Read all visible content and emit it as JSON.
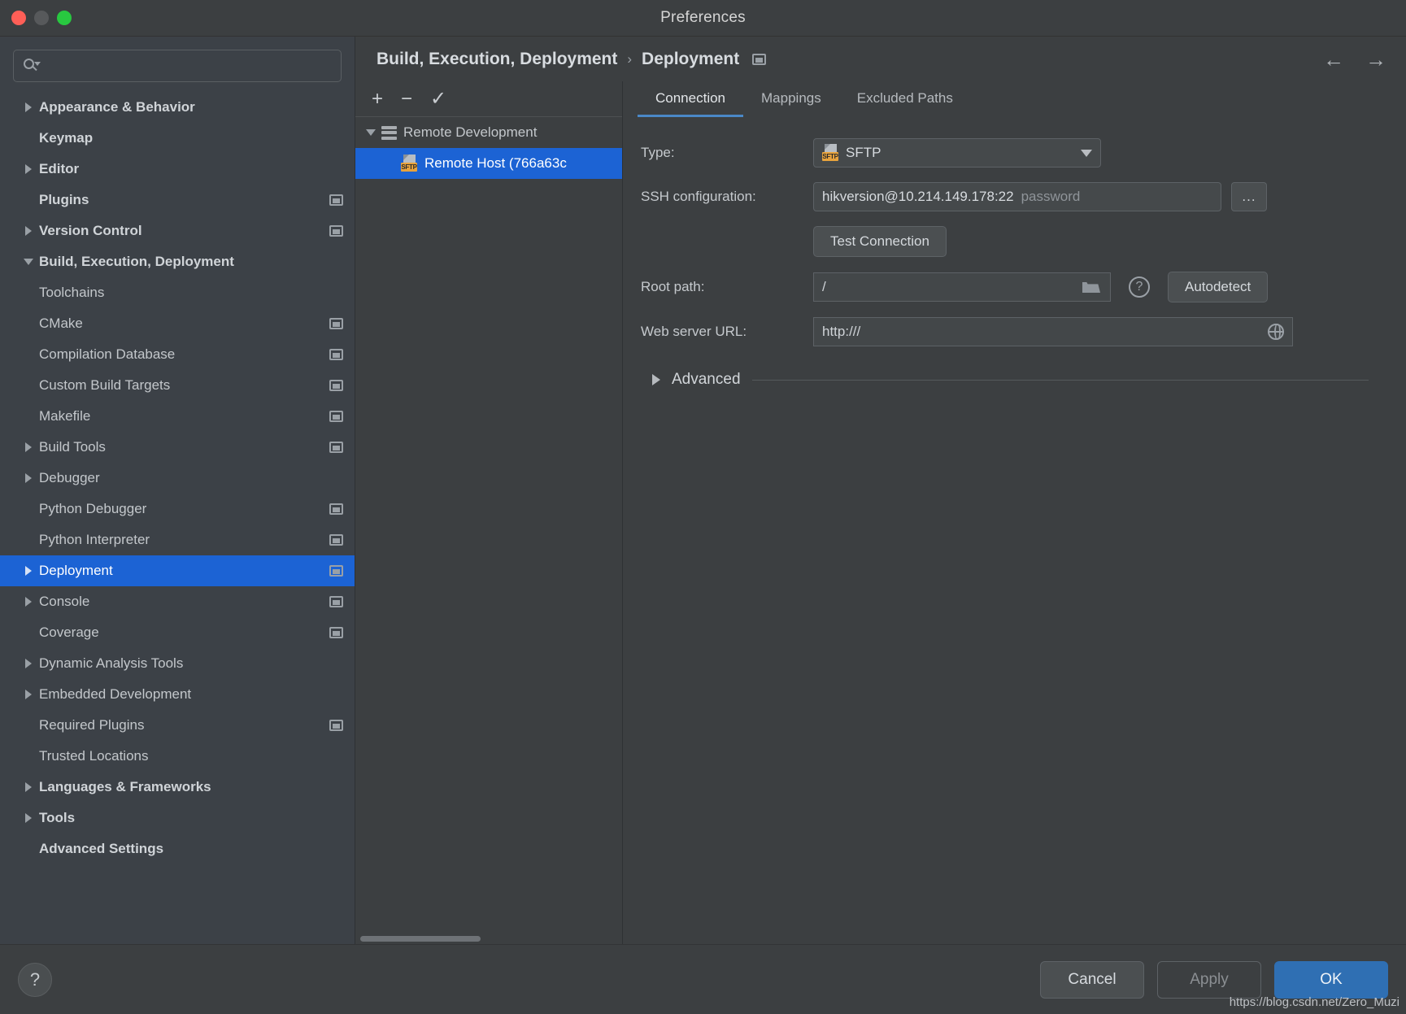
{
  "window": {
    "title": "Preferences",
    "traffic_lights": [
      "close-red",
      "minimize-yellow",
      "zoom-green"
    ]
  },
  "search": {
    "placeholder": "",
    "value": ""
  },
  "sidebar": {
    "items": [
      {
        "label": "Appearance & Behavior",
        "indent": 0,
        "arrow": "right",
        "bold": true,
        "badge": false
      },
      {
        "label": "Keymap",
        "indent": 0,
        "arrow": "none",
        "bold": true,
        "badge": false
      },
      {
        "label": "Editor",
        "indent": 0,
        "arrow": "right",
        "bold": true,
        "badge": false
      },
      {
        "label": "Plugins",
        "indent": 0,
        "arrow": "none",
        "bold": true,
        "badge": true
      },
      {
        "label": "Version Control",
        "indent": 0,
        "arrow": "right",
        "bold": true,
        "badge": true
      },
      {
        "label": "Build, Execution, Deployment",
        "indent": 0,
        "arrow": "down",
        "bold": true,
        "badge": false
      },
      {
        "label": "Toolchains",
        "indent": 1,
        "arrow": "none",
        "bold": false,
        "badge": false
      },
      {
        "label": "CMake",
        "indent": 1,
        "arrow": "none",
        "bold": false,
        "badge": true
      },
      {
        "label": "Compilation Database",
        "indent": 1,
        "arrow": "none",
        "bold": false,
        "badge": true
      },
      {
        "label": "Custom Build Targets",
        "indent": 1,
        "arrow": "none",
        "bold": false,
        "badge": true
      },
      {
        "label": "Makefile",
        "indent": 1,
        "arrow": "none",
        "bold": false,
        "badge": true
      },
      {
        "label": "Build Tools",
        "indent": 1,
        "arrow": "right",
        "bold": false,
        "badge": true
      },
      {
        "label": "Debugger",
        "indent": 1,
        "arrow": "right",
        "bold": false,
        "badge": false
      },
      {
        "label": "Python Debugger",
        "indent": 1,
        "arrow": "none",
        "bold": false,
        "badge": true
      },
      {
        "label": "Python Interpreter",
        "indent": 1,
        "arrow": "none",
        "bold": false,
        "badge": true
      },
      {
        "label": "Deployment",
        "indent": 1,
        "arrow": "right",
        "bold": false,
        "badge": true,
        "selected": true
      },
      {
        "label": "Console",
        "indent": 1,
        "arrow": "right",
        "bold": false,
        "badge": true
      },
      {
        "label": "Coverage",
        "indent": 1,
        "arrow": "none",
        "bold": false,
        "badge": true
      },
      {
        "label": "Dynamic Analysis Tools",
        "indent": 1,
        "arrow": "right",
        "bold": false,
        "badge": false
      },
      {
        "label": "Embedded Development",
        "indent": 1,
        "arrow": "right",
        "bold": false,
        "badge": false
      },
      {
        "label": "Required Plugins",
        "indent": 1,
        "arrow": "none",
        "bold": false,
        "badge": true
      },
      {
        "label": "Trusted Locations",
        "indent": 1,
        "arrow": "none",
        "bold": false,
        "badge": false
      },
      {
        "label": "Languages & Frameworks",
        "indent": 0,
        "arrow": "right",
        "bold": true,
        "badge": false
      },
      {
        "label": "Tools",
        "indent": 0,
        "arrow": "right",
        "bold": true,
        "badge": false
      },
      {
        "label": "Advanced Settings",
        "indent": 0,
        "arrow": "none",
        "bold": true,
        "badge": false
      }
    ]
  },
  "breadcrumb": {
    "parent": "Build, Execution, Deployment",
    "separator": "›",
    "current": "Deployment",
    "badge_icon": "project-scope-icon",
    "back_icon": "←",
    "forward_icon": "→"
  },
  "host_panel": {
    "toolbar": [
      {
        "name": "add-button",
        "glyph": "+"
      },
      {
        "name": "remove-button",
        "glyph": "−"
      },
      {
        "name": "set-default-button",
        "glyph": "✓"
      }
    ],
    "tree": [
      {
        "label": "Remote Development",
        "icon": "server-group-icon",
        "indent": 0,
        "arrow": "down",
        "selected": false
      },
      {
        "label": "Remote Host (766a63c",
        "icon": "sftp-icon",
        "indent": 1,
        "arrow": "none",
        "selected": true
      }
    ],
    "sftp_badge_text": "SFTP"
  },
  "tabs": [
    {
      "label": "Connection",
      "active": true
    },
    {
      "label": "Mappings",
      "active": false
    },
    {
      "label": "Excluded Paths",
      "active": false
    }
  ],
  "form": {
    "type": {
      "label": "Type:",
      "value": "SFTP",
      "icon": "sftp-icon"
    },
    "ssh": {
      "label": "SSH configuration:",
      "value": "hikversion@10.214.149.178:22",
      "hint": "password",
      "more_button": "..."
    },
    "test_connection": {
      "label": "Test Connection"
    },
    "root_path": {
      "label": "Root path:",
      "value": "/",
      "folder_icon": "folder-icon",
      "help_icon": "question-mark-icon",
      "autodetect_label": "Autodetect"
    },
    "web_url": {
      "label": "Web server URL:",
      "value": "http:///",
      "globe_icon": "globe-icon"
    },
    "advanced": {
      "label": "Advanced",
      "expanded": false
    }
  },
  "footer": {
    "help_glyph": "?",
    "cancel": "Cancel",
    "apply": "Apply",
    "ok": "OK",
    "watermark": "https://blog.csdn.net/Zero_Muzi"
  },
  "colors": {
    "accent_blue": "#1c63d4",
    "ok_button": "#2f6fb3",
    "tab_underline": "#4a88c7",
    "panel_bg": "#3c3f41",
    "sidebar_bg": "#3c4147",
    "sftp_badge": "#e8a33d"
  }
}
